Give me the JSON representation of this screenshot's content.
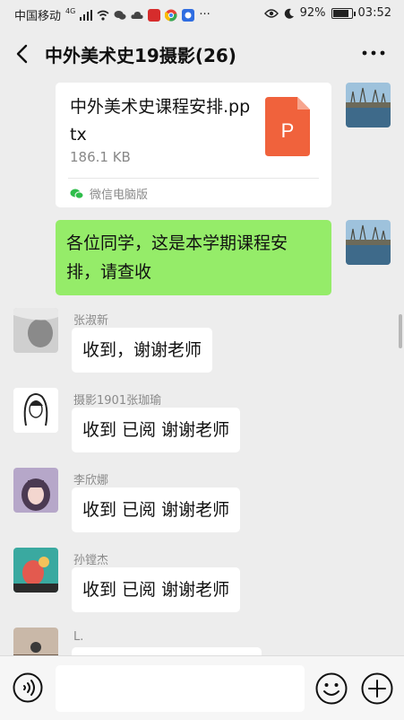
{
  "status_bar": {
    "carrier": "中国移动",
    "network": "4G",
    "battery": "92%",
    "battery_level": 0.92,
    "time": "03:52",
    "more": "···"
  },
  "header": {
    "title": "中外美术史19摄影(26)",
    "back_icon": "back-chevron-icon",
    "more_icon": "more-dots-icon"
  },
  "messages": {
    "file": {
      "name": "中外美术史课程安排.pptx",
      "size": "186.1 KB",
      "source": "微信电脑版",
      "file_letter": "P",
      "file_color": "#f0623c"
    },
    "teacher_text": "各位同学，这是本学期课程安排，请查收",
    "replies": [
      {
        "sender": "张淑新",
        "text": "收到，谢谢老师"
      },
      {
        "sender": "摄影1901张珈瑜",
        "text": "收到 已阅  谢谢老师"
      },
      {
        "sender": "李欣娜",
        "text": "收到 已阅  谢谢老师"
      },
      {
        "sender": "孙镗杰",
        "text": "收到 已阅  谢谢老师"
      },
      {
        "sender": "L.",
        "text": ""
      }
    ]
  },
  "input_bar": {
    "voice_icon": "voice-icon",
    "emoji_icon": "emoji-icon",
    "plus_icon": "plus-icon",
    "input_value": ""
  },
  "colors": {
    "background": "#ededed",
    "own_bubble": "#95ec69",
    "other_bubble": "#ffffff"
  }
}
